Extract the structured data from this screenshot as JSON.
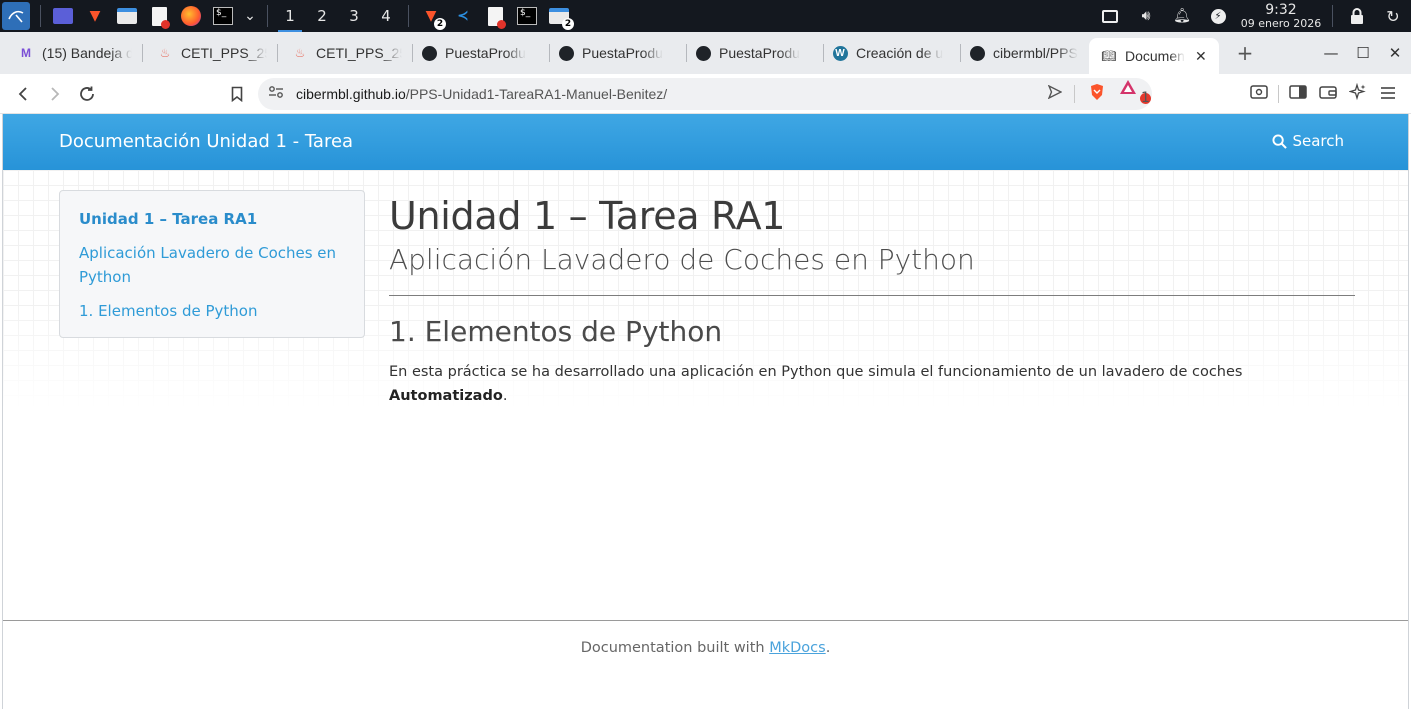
{
  "taskbar": {
    "workspaces": [
      "1",
      "2",
      "3",
      "4"
    ],
    "active_workspace": "1",
    "brave_badge": "2",
    "files_badge": "2",
    "clock_time": "9:32",
    "clock_date": "09 enero 2026",
    "icons": [
      "kali-menu-icon",
      "workspace-switcher-icon",
      "brave-icon",
      "files-icon",
      "editor-icon",
      "firefox-icon",
      "terminal-icon",
      "vscode-icon",
      "display-icon",
      "volume-icon",
      "bell-icon",
      "power-icon",
      "lock-icon",
      "refresh-icon"
    ]
  },
  "tabs": [
    {
      "label": "(15) Bandeja d",
      "icon": "mail-icon"
    },
    {
      "label": "CETI_PPS_25",
      "icon": "ceti-icon"
    },
    {
      "label": "CETI_PPS_25",
      "icon": "ceti-icon"
    },
    {
      "label": "PuestaProdu",
      "icon": "github-icon"
    },
    {
      "label": "PuestaProdu",
      "icon": "github-icon"
    },
    {
      "label": "PuestaProdu",
      "icon": "github-icon"
    },
    {
      "label": "Creación de u",
      "icon": "wordpress-icon"
    },
    {
      "label": "cibermbl/PPS",
      "icon": "github-icon"
    },
    {
      "label": "Documen",
      "icon": "book-icon",
      "active": true
    }
  ],
  "address": {
    "host": "cibermbl.github.io",
    "path": "/PPS-Unidad1-TareaRA1-Manuel-Benitez/",
    "rewards_badge": "1"
  },
  "site": {
    "name": "Documentación Unidad 1 - Tarea",
    "search_label": "Search"
  },
  "toc": [
    {
      "label": "Unidad 1 – Tarea RA1",
      "level": "top"
    },
    {
      "label": "Aplicación Lavadero de Coches en Python",
      "level": "sub"
    },
    {
      "label": "1. Elementos de Python",
      "level": "sub"
    }
  ],
  "content": {
    "title": "Unidad 1 – Tarea RA1",
    "subtitle": "Aplicación Lavadero de Coches en Python",
    "section_title": "1. Elementos de Python",
    "paragraph_text": "En esta práctica se ha desarrollado una aplicación en Python que simula el funcionamiento de un lavadero de coches ",
    "paragraph_bold": "Automatizado",
    "paragraph_end": "."
  },
  "footer": {
    "prefix": "Documentation built with ",
    "link_label": "MkDocs",
    "suffix": "."
  },
  "colors": {
    "header_blue": "#2f9bde",
    "link_blue": "#2f9bd7",
    "taskbar_bg": "#14181f"
  }
}
